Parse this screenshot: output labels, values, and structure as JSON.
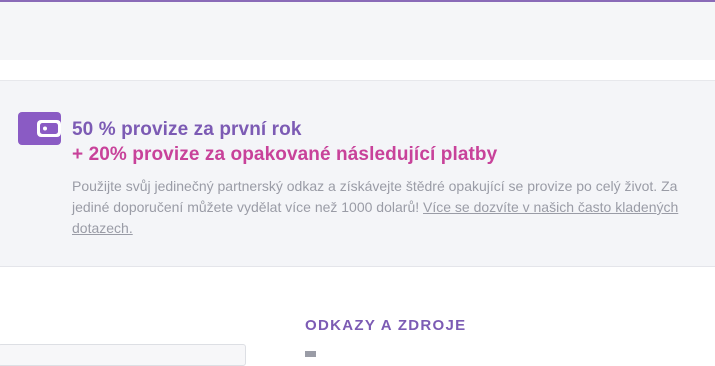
{
  "promo": {
    "icon": "wallet-icon",
    "headline_primary": "50 % provize za první rok",
    "headline_secondary": "+ 20% provize za opakované následující platby",
    "description": "Použijte svůj jedinečný partnerský odkaz a získávejte štědré opakující se provize po celý život. Za jediné doporučení můžete vydělat více než 1000 dolarů!",
    "faq_link": "Více se dozvíte v našich často kladených dotazech."
  },
  "resources": {
    "title": "ODKAZY A ZDROJE"
  },
  "colors": {
    "purple": "#7c5bb4",
    "magenta": "#c8429a",
    "muted_text": "#9a9ca6",
    "panel_bg": "#f4f5f8"
  }
}
